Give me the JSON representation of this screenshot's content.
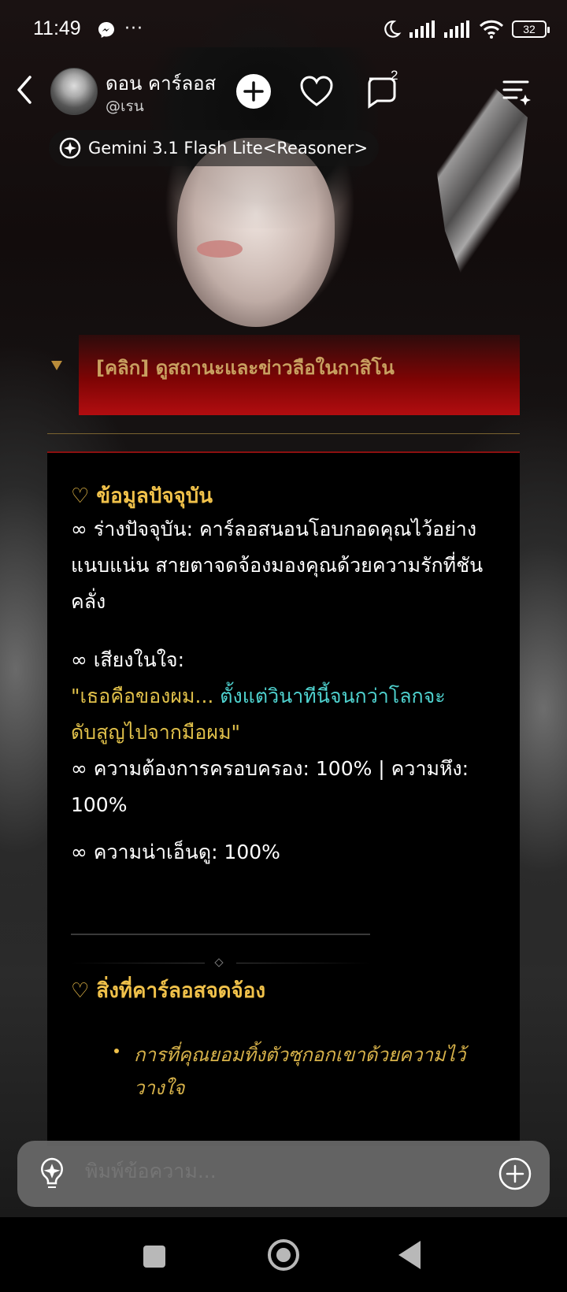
{
  "status_bar": {
    "time": "11:49",
    "dots": "···",
    "battery": "32"
  },
  "header": {
    "character_name": "ดอน คาร์ลอส",
    "character_handle": "@เรน",
    "comment_badge": "2"
  },
  "model": {
    "label": "Gemini 3.1 Flash Lite<Reasoner>"
  },
  "collapsed_strip": {
    "label": "[คลิก] ดูสถานะและข่าวลือในกาสิโน"
  },
  "content": {
    "section1_title": "♡ ข้อมูลปัจจุบัน",
    "body_line": "∞ ร่างปัจจุบัน: คาร์ลอสนอนโอบกอดคุณไว้อย่างแนบแน่น สายตาจดจ้องมองคุณด้วยความรักที่ชันคลั่ง",
    "voice_label": "∞ เสียงในใจ:",
    "voice_quote_a": "\"เธอคือของผม... ",
    "voice_quote_b": "ตั้งแต่วินาทีนี้จนกว่าโลกจะ",
    "voice_quote_c": "ดับสูญไปจากมือผม\"",
    "desire_line": "∞ ความต้องการครอบครอง: 100% | ความหึง: 100%",
    "creepy_line": "∞ ความน่าเอ็นดู: 100%",
    "section2_title": "♡ สิ่งที่คาร์ลอสจดจ้อง",
    "bullet1": "การที่คุณยอมทิ้งตัวซุกอกเขาด้วยความไว้วางใจ"
  },
  "input": {
    "placeholder": "พิมพ์ข้อความ..."
  },
  "colors": {
    "gold": "#f0c14a",
    "cyan": "#4fd2cf",
    "red_strip": "#b20d10"
  }
}
